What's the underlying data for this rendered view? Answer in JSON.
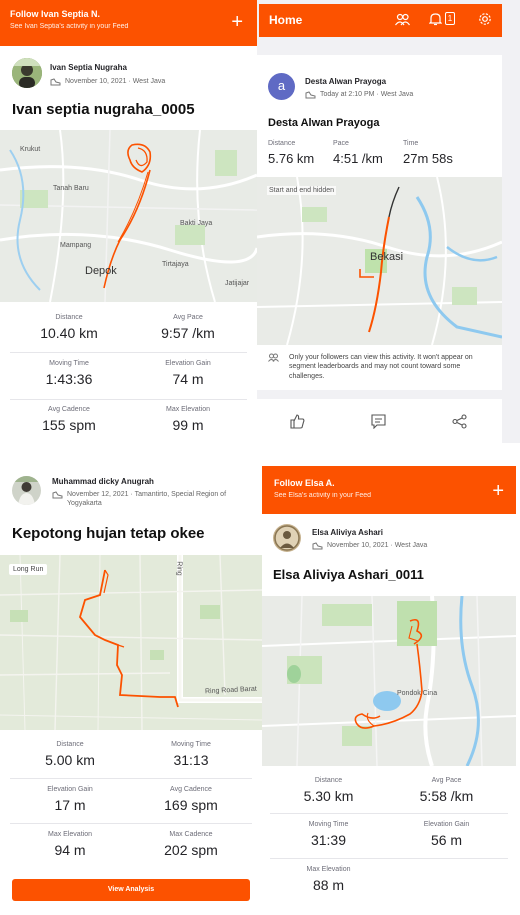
{
  "panel_tl": {
    "follow_title": "Follow Ivan Septia N.",
    "follow_sub": "See Ivan Septia's activity in your Feed",
    "athlete": "Ivan Septia Nugraha",
    "meta": "November 10, 2021 · West Java",
    "title": "Ivan septia nugraha_0005",
    "map_labels": [
      "Krukut",
      "Tanah Baru",
      "Bakti Jaya",
      "Mampang",
      "Depok",
      "Tirtajaya",
      "Jatijajar"
    ],
    "stats": [
      {
        "label": "Distance",
        "value": "10.40 km"
      },
      {
        "label": "Avg Pace",
        "value": "9:57 /km"
      },
      {
        "label": "Moving Time",
        "value": "1:43:36"
      },
      {
        "label": "Elevation Gain",
        "value": "74 m"
      },
      {
        "label": "Avg Cadence",
        "value": "155 spm"
      },
      {
        "label": "Max Elevation",
        "value": "99 m"
      }
    ]
  },
  "panel_tr": {
    "header_title": "Home",
    "notif_count": "1",
    "athlete": "Desta Alwan Prayoga",
    "avatar_letter": "a",
    "meta": "Today at 2:10 PM · West Java",
    "title": "Desta Alwan Prayoga",
    "stats": [
      {
        "label": "Distance",
        "value": "5.76 km"
      },
      {
        "label": "Pace",
        "value": "4:51 /km"
      },
      {
        "label": "Time",
        "value": "27m 58s"
      }
    ],
    "map_note": "Start and end hidden",
    "map_city": "Bekasi",
    "privacy_note": "Only your followers can view this activity. It won't appear on segment leaderboards and may not count toward some challenges."
  },
  "panel_bl": {
    "athlete": "Muhammad dicky Anugrah",
    "meta": "November 12, 2021 · Tamantirto, Special Region of Yogyakarta",
    "title": "Kepotong hujan tetap okee",
    "map_tag": "Long Run",
    "map_labels": [
      "Ring Road Barat",
      "Ring"
    ],
    "stats": [
      {
        "label": "Distance",
        "value": "5.00 km"
      },
      {
        "label": "Moving Time",
        "value": "31:13"
      },
      {
        "label": "Elevation Gain",
        "value": "17 m"
      },
      {
        "label": "Avg Cadence",
        "value": "169 spm"
      },
      {
        "label": "Max Elevation",
        "value": "94 m"
      },
      {
        "label": "Max Cadence",
        "value": "202 spm"
      }
    ],
    "button": "View Analysis"
  },
  "panel_br": {
    "follow_title": "Follow Elsa A.",
    "follow_sub": "See Elsa's activity in your Feed",
    "athlete": "Elsa Aliviya Ashari",
    "meta": "November 10, 2021 · West Java",
    "title": "Elsa Aliviya Ashari_0011",
    "map_labels": [
      "Pondok Cina"
    ],
    "stats": [
      {
        "label": "Distance",
        "value": "5.30 km"
      },
      {
        "label": "Avg Pace",
        "value": "5:58 /km"
      },
      {
        "label": "Moving Time",
        "value": "31:39"
      },
      {
        "label": "Elevation Gain",
        "value": "56 m"
      },
      {
        "label": "Max Elevation",
        "value": "88 m"
      }
    ]
  },
  "colors": {
    "accent": "#fc5200",
    "route": "#fc5200",
    "map_bg": "#e9ece8",
    "park": "#c8e6b9",
    "water": "#8ec9ef"
  }
}
